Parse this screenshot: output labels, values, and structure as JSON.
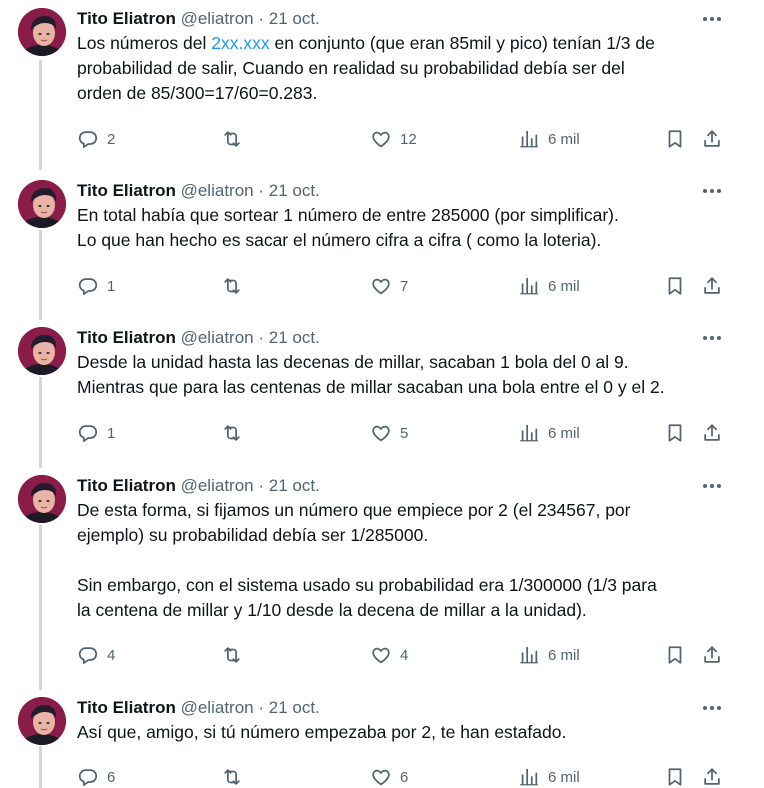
{
  "tweets": [
    {
      "name": "Tito Eliatron",
      "handle": "@eliatron",
      "separator": "·",
      "date": "21 oct.",
      "lines": [
        {
          "before": "Los números del ",
          "link": "2xx.xxx",
          "after": " en conjunto (que eran 85mil y pico) tenían 1/3 de"
        },
        {
          "text": "probabilidad de salir, Cuando en realidad su probabilidad debía ser del"
        },
        {
          "text": "orden de 85/300=17/60=0.283."
        }
      ],
      "replies": "2",
      "retweets": "",
      "likes": "12",
      "views": "6 mil"
    },
    {
      "name": "Tito Eliatron",
      "handle": "@eliatron",
      "separator": "·",
      "date": "21 oct.",
      "lines": [
        {
          "text": "En total había que sortear 1 número de entre 285000 (por simplificar)."
        },
        {
          "text": "Lo que han hecho es sacar el número cifra a cifra ( como la loteria)."
        }
      ],
      "replies": "1",
      "retweets": "",
      "likes": "7",
      "views": "6 mil"
    },
    {
      "name": "Tito Eliatron",
      "handle": "@eliatron",
      "separator": "·",
      "date": "21 oct.",
      "lines": [
        {
          "text": "Desde la unidad hasta las decenas de millar, sacaban 1 bola del 0 al 9."
        },
        {
          "text": "Mientras que para las centenas de millar sacaban una bola entre el 0 y el 2."
        }
      ],
      "replies": "1",
      "retweets": "",
      "likes": "5",
      "views": "6 mil"
    },
    {
      "name": "Tito Eliatron",
      "handle": "@eliatron",
      "separator": "·",
      "date": "21 oct.",
      "lines": [
        {
          "text": "De esta forma, si fijamos un número que empiece por 2 (el 234567, por"
        },
        {
          "text": "ejemplo) su probabilidad debía ser 1/285000."
        },
        {
          "text": ""
        },
        {
          "text": "Sin embargo, con el sistema usado su probabilidad era 1/300000 (1/3 para"
        },
        {
          "text": "la centena de millar y 1/10 desde la decena de millar a la unidad)."
        }
      ],
      "replies": "4",
      "retweets": "",
      "likes": "4",
      "views": "6 mil"
    },
    {
      "name": "Tito Eliatron",
      "handle": "@eliatron",
      "separator": "·",
      "date": "21 oct.",
      "lines": [
        {
          "text": "Así que, amigo, si tú número empezaba por 2, te han estafado."
        }
      ],
      "replies": "6",
      "retweets": "",
      "likes": "6",
      "views": "6 mil"
    }
  ],
  "icons": {
    "reply": "reply-icon",
    "retweet": "retweet-icon",
    "like": "heart-icon",
    "views": "views-icon",
    "bookmark": "bookmark-icon",
    "share": "share-icon",
    "more": "more-icon"
  },
  "colors": {
    "text": "#0f1419",
    "secondary": "#536471",
    "link": "#1d9bf0",
    "thread_line": "#cfd9de",
    "avatar_bg": "#8a1c4a"
  }
}
